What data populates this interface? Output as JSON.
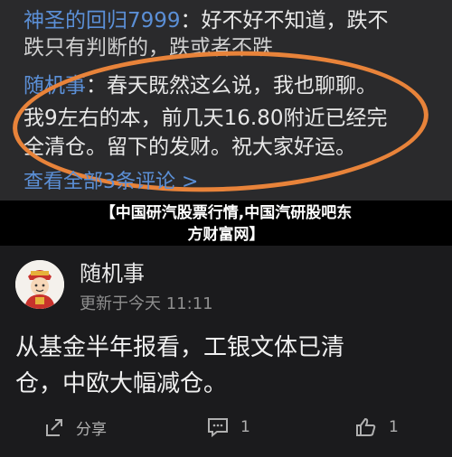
{
  "replies": [
    {
      "user": "神圣的回归7999",
      "text_line1": "：好不好不知道，跌不",
      "text_line2": "跌只有判断的，跌或者不跌"
    },
    {
      "user": "随机事",
      "text_line1": "：春天既然这么说，我也聊聊。",
      "text_line2": "我9左右的本，前几天16.80附近已经完",
      "text_line3": "全清仓。留下的发财。祝大家好运。"
    }
  ],
  "view_all": "查看全部3条评论 >",
  "banner": {
    "line1": "【中国研汽股票行情,中国汽研股吧东",
    "line2": "方财富网】"
  },
  "post": {
    "author": "随机事",
    "time": "更新于今天 11:11",
    "body_line1": "从基金半年报看，工银文体已清",
    "body_line2": "仓，中欧大幅减仓。"
  },
  "actions": {
    "share_label": "分享",
    "comment_count": "1",
    "like_count": "1"
  },
  "icons": {
    "share": "share-icon",
    "comment": "comment-icon",
    "like": "thumbs-up-icon"
  }
}
